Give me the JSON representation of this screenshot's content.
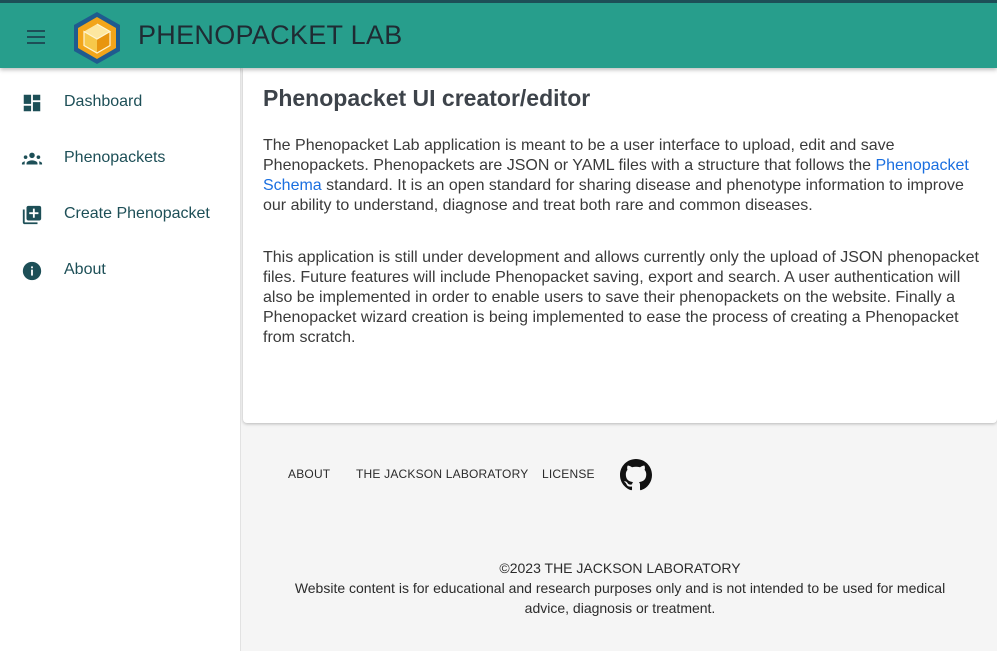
{
  "app": {
    "title": "PHENOPACKET LAB",
    "colors": {
      "toolbar": "#279e8c",
      "toolbar_border": "#1d4f57",
      "nav_text": "#1d4f57",
      "link": "#1a6fe0"
    }
  },
  "sidebar": {
    "items": [
      {
        "label": "Dashboard",
        "icon": "dashboard-icon"
      },
      {
        "label": "Phenopackets",
        "icon": "groups-icon"
      },
      {
        "label": "Create Phenopacket",
        "icon": "library-add-icon"
      },
      {
        "label": "About",
        "icon": "info-icon"
      }
    ]
  },
  "main": {
    "heading": "Phenopacket UI creator/editor",
    "p1_before": "The Phenopacket Lab application is meant to be a user interface to upload, edit and save Phenopackets. Phenopackets are JSON or YAML files with a structure that follows the ",
    "p1_link": "Phenopacket Schema",
    "p1_after": " standard. It is an open standard for sharing disease and phenotype information to improve our ability to understand, diagnose and treat both rare and common diseases.",
    "p2": "This application is still under development and allows currently only the upload of JSON phenopacket files. Future features will include Phenopacket saving, export and search. A user authentication will also be implemented in order to enable users to save their phenopackets on the website. Finally a Phenopacket wizard creation is being implemented to ease the process of creating a Phenopacket from scratch."
  },
  "footer": {
    "links": [
      "ABOUT",
      "THE JACKSON LABORATORY",
      "LICENSE"
    ],
    "github_icon": "github-icon",
    "copyright": "©2023 THE JACKSON LABORATORY",
    "disclaimer": "Website content is for educational and research purposes only and is not intended to be used for medical advice, diagnosis or treatment."
  }
}
